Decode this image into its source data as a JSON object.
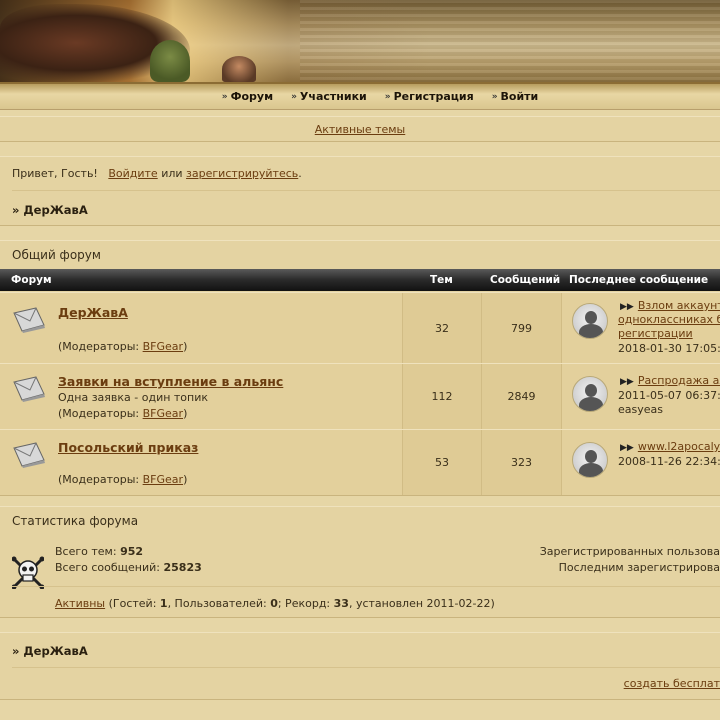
{
  "nav": {
    "items": [
      {
        "label": "Форум"
      },
      {
        "label": "Участники"
      },
      {
        "label": "Регистрация"
      },
      {
        "label": "Войти"
      }
    ]
  },
  "active_topics": "Активные темы",
  "welcome": {
    "greeting": "Привет, Гость!",
    "login_link": "Войдите",
    "or": "или",
    "register_link": "зарегистрируйтесь",
    "period": ".",
    "crumb": "» ДерЖавА"
  },
  "forum_section": {
    "title": "Общий форум",
    "headers": {
      "forum": "Форум",
      "topics": "Тем",
      "posts": "Сообщений",
      "last": "Последнее сообщение"
    },
    "rows": [
      {
        "name": "ДерЖавА",
        "desc": "",
        "mods_prefix": "(Модераторы: ",
        "mod": "BFGear",
        "mods_suffix": ")",
        "topics": "32",
        "posts": "799",
        "last_title": "Взлом аккаунт",
        "last_title_2": "одноклассниках б",
        "last_title_3": "регистрации",
        "last_date": "2018-01-30 17:05:",
        "last_author": ""
      },
      {
        "name": "Заявки на вступление в альянс",
        "desc": "Одна заявка - один топик",
        "mods_prefix": "(Модераторы: ",
        "mod": "BFGear",
        "mods_suffix": ")",
        "topics": "112",
        "posts": "2849",
        "last_title": "Распродажа ал",
        "last_date": "2011-05-07 06:37:",
        "last_author": "easyeas"
      },
      {
        "name": "Посольский приказ",
        "desc": "",
        "mods_prefix": "(Модераторы: ",
        "mod": "BFGear",
        "mods_suffix": ")",
        "topics": "53",
        "posts": "323",
        "last_title": "www.l2apocalyp",
        "last_date": "2008-11-26 22:34:",
        "last_author": ""
      }
    ]
  },
  "stats": {
    "title": "Статистика форума",
    "total_topics_label": "Всего тем:",
    "total_topics": "952",
    "total_posts_label": "Всего сообщений:",
    "total_posts": "25823",
    "registered_label": "Зарегистрированных пользова",
    "last_registered_label": "Последним зарегистрирова",
    "active_link": "Активны",
    "guests_label": " (Гостей: ",
    "guests": "1",
    "users_label": ", Пользователей: ",
    "users": "0",
    "record_label": "; Рекорд: ",
    "record": "33",
    "record_date": ", установлен 2011-02-22)"
  },
  "footer": {
    "crumb": "» ДерЖавА",
    "create_link": "создать бесплат"
  }
}
